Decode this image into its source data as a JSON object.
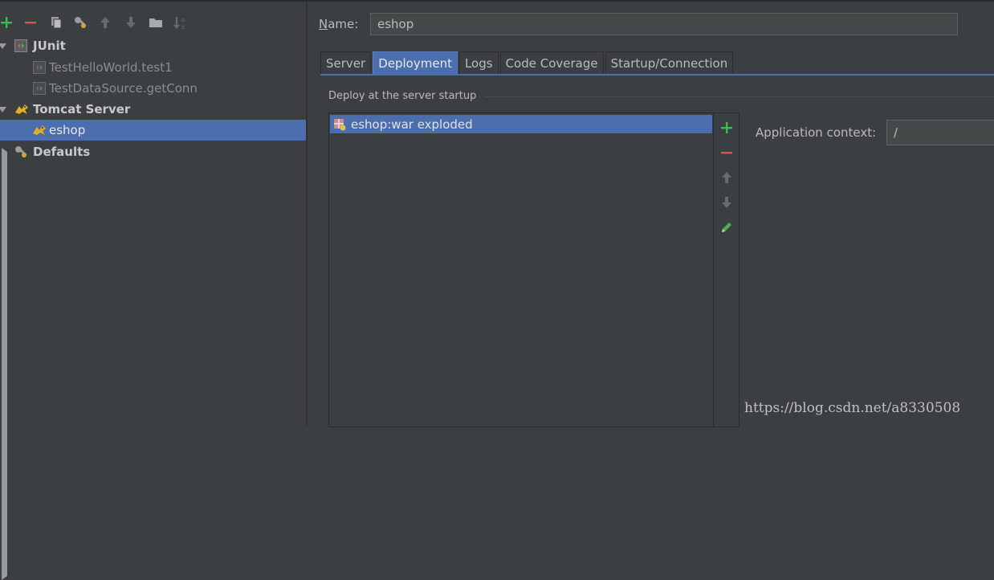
{
  "tree": {
    "groups": [
      {
        "label": "JUnit",
        "expanded": true,
        "icon": "junit-icon",
        "children": [
          {
            "label": "TestHelloWorld.test1"
          },
          {
            "label": "TestDataSource.getConn"
          }
        ]
      },
      {
        "label": "Tomcat Server",
        "expanded": true,
        "icon": "tomcat-icon",
        "children": [
          {
            "label": "eshop",
            "selected": true
          }
        ]
      },
      {
        "label": "Defaults",
        "expanded": false,
        "icon": "wrench-icon",
        "children": []
      }
    ]
  },
  "toolbar": {
    "icons": [
      "add-icon",
      "remove-icon",
      "copy-icon",
      "wrench-icon",
      "move-up-icon",
      "move-down-icon",
      "folder-icon",
      "sort-az-icon"
    ]
  },
  "config": {
    "name_label": "Name:",
    "name_value": "eshop",
    "tabs": [
      {
        "label": "Server",
        "active": false
      },
      {
        "label": "Deployment",
        "active": true
      },
      {
        "label": "Logs",
        "active": false
      },
      {
        "label": "Code Coverage",
        "active": false
      },
      {
        "label": "Startup/Connection",
        "active": false
      }
    ],
    "deploy_title": "Deploy at the server startup",
    "artifacts": [
      "eshop:war exploded"
    ],
    "side_tools": [
      "add-icon",
      "remove-icon",
      "move-up-icon",
      "move-down-icon",
      "edit-icon"
    ],
    "app_context_label": "Application context:",
    "app_context_value": "/"
  },
  "watermark": "https://blog.csdn.net/a8330508",
  "colors": {
    "background": "#3c3f41",
    "selection": "#4b6eaf",
    "add": "#3fb950",
    "remove": "#d9534f"
  }
}
